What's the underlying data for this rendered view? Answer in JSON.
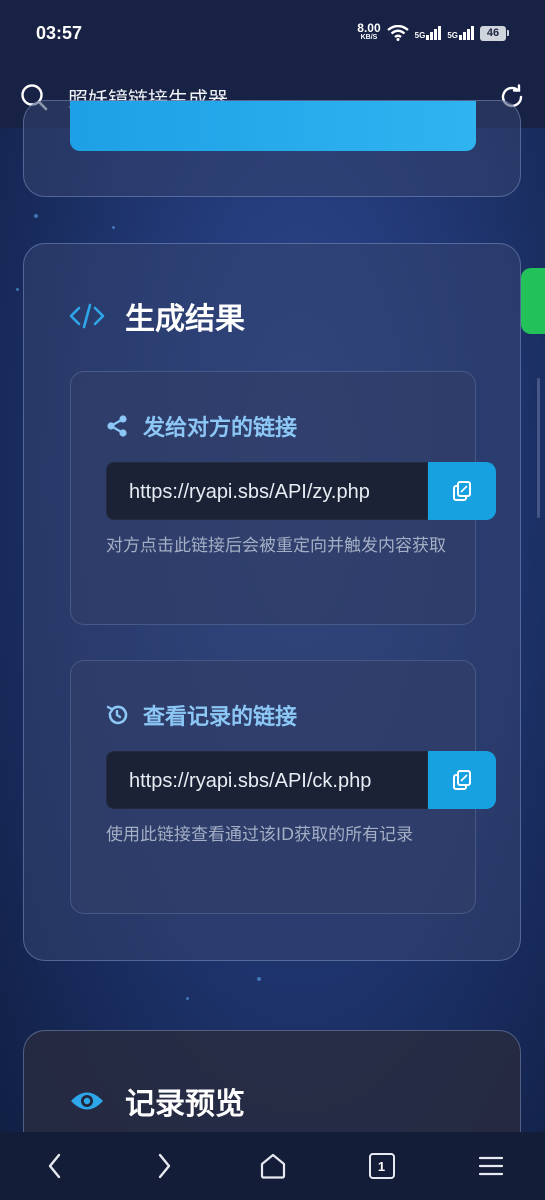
{
  "status": {
    "time": "03:57",
    "net_speed": "8.00",
    "net_unit": "KB/S",
    "sig1": "5G",
    "sig2": "5G",
    "battery": "46"
  },
  "toolbar": {
    "title": "照妖镜链接生成器"
  },
  "result": {
    "heading": "生成结果",
    "send_link": {
      "title": "发给对方的链接",
      "url": "https://ryapi.sbs/API/zy.php",
      "hint": "对方点击此链接后会被重定向并触发内容获取"
    },
    "view_link": {
      "title": "查看记录的链接",
      "url": "https://ryapi.sbs/API/ck.php",
      "hint": "使用此链接查看通过该ID获取的所有记录"
    }
  },
  "preview": {
    "heading": "记录预览"
  },
  "nav": {
    "tab_count": "1"
  },
  "colors": {
    "accent": "#17a1e0",
    "link_title": "#8cc7f5",
    "side_tab": "#23c15a"
  },
  "icons": {
    "search": "search-icon",
    "refresh": "refresh-icon",
    "code": "code-icon",
    "share": "share-icon",
    "history": "history-icon",
    "copy": "copy-icon",
    "eye": "eye-icon"
  }
}
